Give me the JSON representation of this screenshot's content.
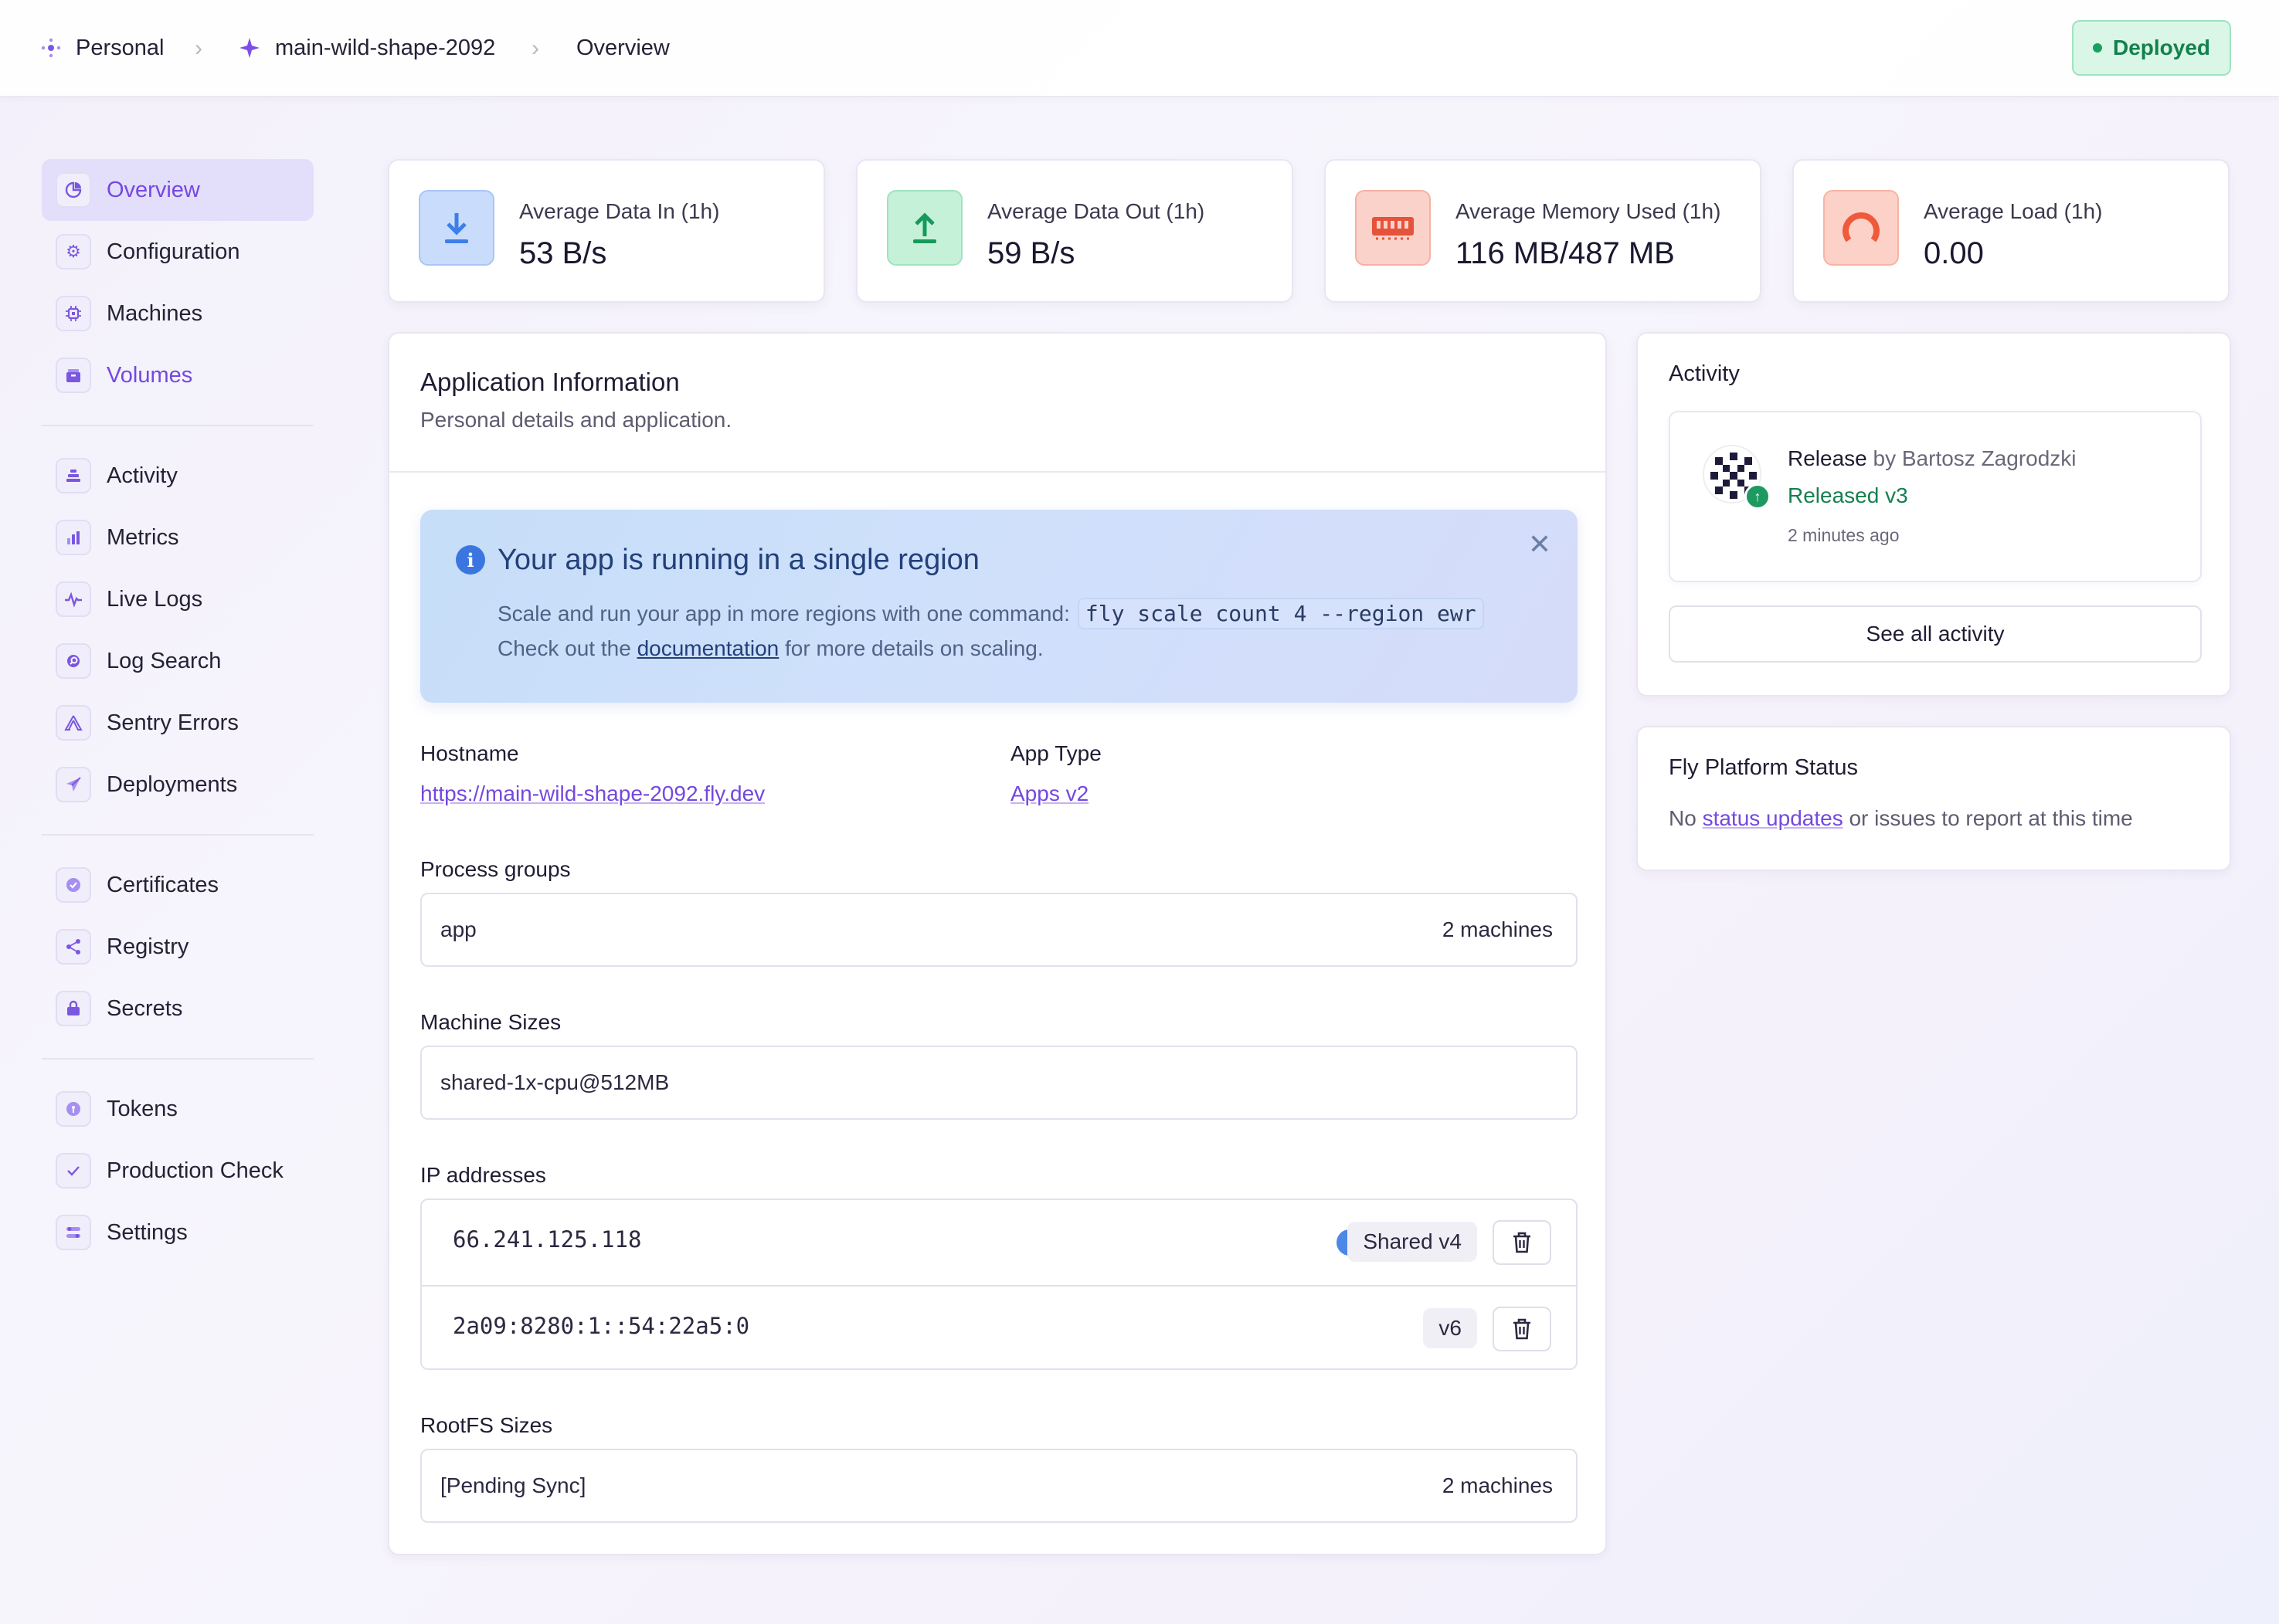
{
  "breadcrumb": {
    "org": "Personal",
    "app": "main-wild-shape-2092",
    "page": "Overview",
    "separator": "›"
  },
  "status": {
    "label": "Deployed",
    "color": "#15804f"
  },
  "sidebar": {
    "items": [
      {
        "label": "Overview",
        "icon": "chart-pie-icon"
      },
      {
        "label": "Configuration",
        "icon": "gear-icon"
      },
      {
        "label": "Machines",
        "icon": "cpu-icon"
      },
      {
        "label": "Volumes",
        "icon": "box-icon"
      },
      {
        "label": "Activity",
        "icon": "stack-icon"
      },
      {
        "label": "Metrics",
        "icon": "bar-chart-icon"
      },
      {
        "label": "Live Logs",
        "icon": "pulse-icon"
      },
      {
        "label": "Log Search",
        "icon": "search-icon"
      },
      {
        "label": "Sentry Errors",
        "icon": "sentry-icon"
      },
      {
        "label": "Deployments",
        "icon": "paper-plane-icon"
      },
      {
        "label": "Certificates",
        "icon": "check-badge-icon"
      },
      {
        "label": "Registry",
        "icon": "share-icon"
      },
      {
        "label": "Secrets",
        "icon": "lock-icon"
      },
      {
        "label": "Tokens",
        "icon": "token-icon"
      },
      {
        "label": "Production Check",
        "icon": "check-icon"
      },
      {
        "label": "Settings",
        "icon": "toggles-icon"
      }
    ]
  },
  "stats": [
    {
      "label": "Average Data In (1h)",
      "value": "53 B/s",
      "icon": "download-icon",
      "color": "#3d7fe6"
    },
    {
      "label": "Average Data Out (1h)",
      "value": "59 B/s",
      "icon": "upload-icon",
      "color": "#159a5c"
    },
    {
      "label": "Average Memory Used (1h)",
      "value": "116 MB/487 MB",
      "icon": "memory-icon",
      "color": "#e5533a"
    },
    {
      "label": "Average Load (1h)",
      "value": "0.00",
      "icon": "gauge-icon",
      "color": "#ef5a3a"
    }
  ],
  "app_info": {
    "title": "Application Information",
    "subtitle": "Personal details and application.",
    "banner": {
      "title": "Your app is running in a single region",
      "line1_prefix": "Scale and run your app in more regions with one command:",
      "command": "fly scale count 4 --region ewr",
      "line2_prefix": "Check out the",
      "link": "documentation",
      "line2_suffix": "for more details on scaling.",
      "close": "✕"
    },
    "hostname_label": "Hostname",
    "hostname": "https://main-wild-shape-2092.fly.dev",
    "app_type_label": "App Type",
    "app_type": "Apps v2",
    "process_groups_label": "Process groups",
    "process_group": {
      "name": "app",
      "count": "2 machines"
    },
    "machine_sizes_label": "Machine Sizes",
    "machine_size": "shared-1x-cpu@512MB",
    "ip_label": "IP addresses",
    "ips": [
      {
        "address": "66.241.125.118",
        "type": "Shared v4"
      },
      {
        "address": "2a09:8280:1::54:22a5:0",
        "type": "v6"
      }
    ],
    "rootfs_label": "RootFS Sizes",
    "rootfs": {
      "name": "[Pending Sync]",
      "count": "2 machines"
    }
  },
  "activity": {
    "title": "Activity",
    "item": {
      "action": "Release",
      "by": "by Bartosz Zagrodzki",
      "status": "Released v3",
      "time": "2 minutes ago"
    },
    "see_all": "See all activity"
  },
  "platform": {
    "title": "Fly Platform Status",
    "prefix": "No",
    "link": "status updates",
    "suffix": "or issues to report at this time"
  }
}
